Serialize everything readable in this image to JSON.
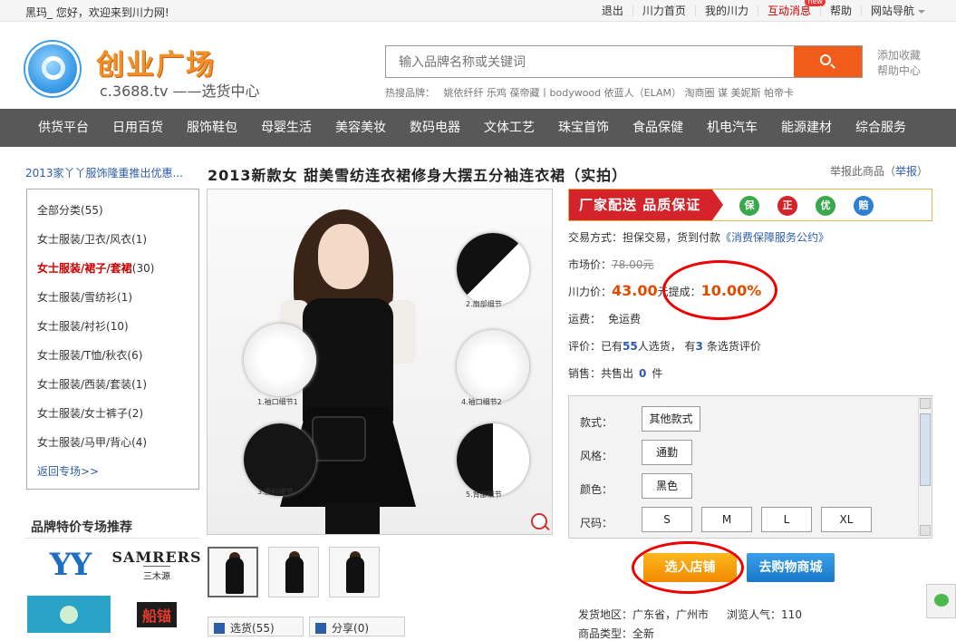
{
  "topbar": {
    "welcome": "黑玛_ 您好，欢迎来到川力网!",
    "links": [
      "退出",
      "川力首页",
      "我的川力",
      "互动消息",
      "帮助",
      "网站导航"
    ],
    "new_badge": "new"
  },
  "header": {
    "logo_title": "创业广场",
    "logo_sub": "c.3688.tv ——选货中心",
    "search_placeholder": "输入品牌名称或关键词",
    "hot_label": "热搜品牌：",
    "hot_brands": [
      "姚依纤纤",
      "乐鸡",
      "葆帝藏丨bodywood",
      "依蓝人（ELAM）",
      "淘商圈",
      "谋",
      "美妮斯",
      "帕帝卡"
    ],
    "side_links": [
      "添加收藏",
      "帮助中心"
    ]
  },
  "nav": [
    "供货平台",
    "日用百货",
    "服饰鞋包",
    "母婴生活",
    "美容美妆",
    "数码电器",
    "文体工艺",
    "珠宝首饰",
    "食品保健",
    "机电汽车",
    "能源建材",
    "综合服务"
  ],
  "sidebar": {
    "promo": "2013家丫丫服饰隆重推出优惠...",
    "categories": [
      {
        "label": "全部分类",
        "count": "(55)"
      },
      {
        "label": "女士服装/卫衣/风衣",
        "count": "(1)"
      },
      {
        "label": "女士服装/裙子/套裙",
        "count": "(30)"
      },
      {
        "label": "女士服装/雪纺衫",
        "count": "(1)"
      },
      {
        "label": "女士服装/衬衫",
        "count": "(10)"
      },
      {
        "label": "女士服装/T恤/秋衣",
        "count": "(6)"
      },
      {
        "label": "女士服装/西装/套装",
        "count": "(1)"
      },
      {
        "label": "女士服装/女士裤子",
        "count": "(2)"
      },
      {
        "label": "女士服装/马甲/背心",
        "count": "(4)"
      }
    ],
    "back_link": "返回专场>>",
    "brand_title": "品牌特价专场推荐",
    "brands": {
      "yy": "YY",
      "samrers": "SAMRERS",
      "samrers_sub": "三木源",
      "red_logo": "船锚"
    }
  },
  "product": {
    "title": "2013新款女 甜美雪纺连衣裙修身大摆五分袖连衣裙（实拍）",
    "report_prefix": "举报此商品（",
    "report_link": "举报",
    "report_suffix": "）",
    "detail_labels": [
      "2.扇部细节",
      "1.袖口细节1",
      "4.袖口细节2",
      "3.面料细节",
      "5.背部细节"
    ],
    "buttons": {
      "pick": "选货",
      "pick_count": "(55)",
      "share": "分享",
      "share_count": "(0)"
    }
  },
  "guarantee": {
    "text": "厂家配送 品质保证",
    "icons": [
      "保",
      "正",
      "优",
      "赔"
    ],
    "colors": {
      "red": "#d5232b",
      "green": "#3aa84a",
      "blue": "#2e7fd0"
    }
  },
  "info": {
    "trade_label": "交易方式：",
    "trade_value": "担保交易，货到付款",
    "trade_link": "《消费保障服务公约》",
    "market_label": "市场价：",
    "market_price": "78.00元",
    "price_label": "川力价：",
    "price": "43.00",
    "price_unit": "元",
    "commission_label": "提成：",
    "commission": "10.00%",
    "shipping_label": "运费：",
    "shipping_value": "免运费",
    "rating_label": "评价：已有",
    "rating_count": "55",
    "rating_mid": "人选货，  有",
    "rating_reviews": "3",
    "rating_suffix": "条选货评价",
    "sales_label": "销售：共售出",
    "sales_count": "0",
    "sales_unit": "件"
  },
  "spec": {
    "style_label": "款式：",
    "style_value": "其他款式",
    "fashion_label": "风格：",
    "fashion_value": "通勤",
    "color_label": "颜色：",
    "color_value": "黑色",
    "size_label": "尺码：",
    "sizes": [
      "S",
      "M",
      "L",
      "XL"
    ]
  },
  "actions": {
    "add_store": "选入店铺",
    "go_shop": "去购物商城"
  },
  "bottom": {
    "origin_label": "发货地区：",
    "origin": "广东省，广州市",
    "views_label": "浏览人气：",
    "views": "110",
    "category_label": "商品类型：全新"
  }
}
